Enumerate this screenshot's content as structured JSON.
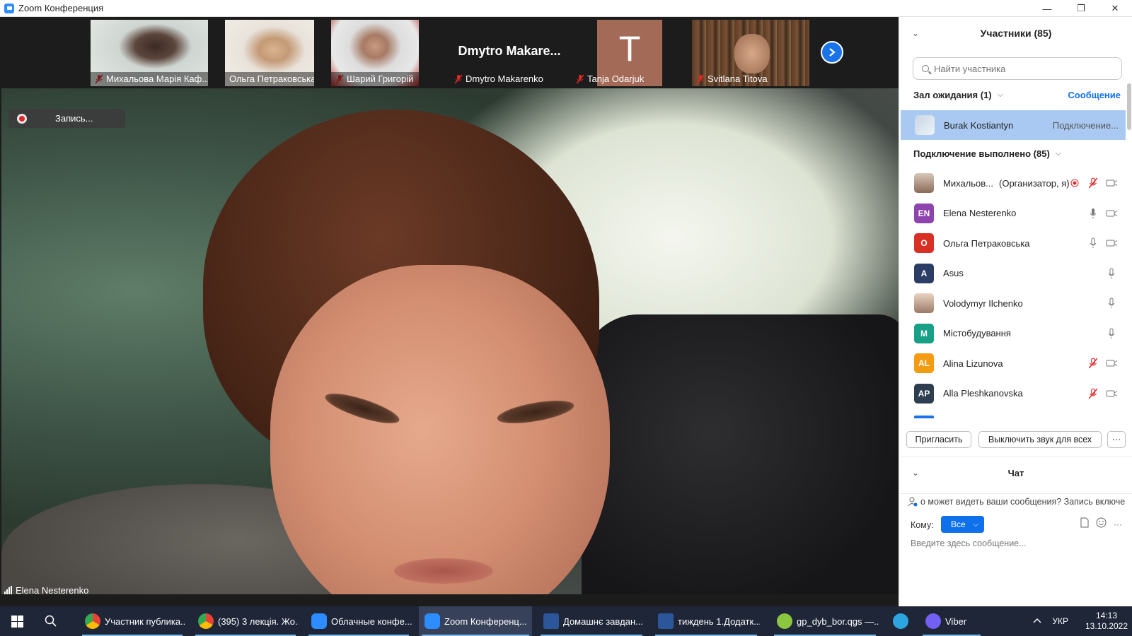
{
  "window": {
    "title": "Zoom Конференция",
    "minimize": "—",
    "maximize": "❐",
    "close": "✕"
  },
  "thumbnails": [
    {
      "name": "Михальова Марія Каф..."
    },
    {
      "name": "Ольга Петраковська"
    },
    {
      "name": "Шарий Григорій"
    },
    {
      "name": "Dmytro Makarenko",
      "display_text": "Dmytro  Makare..."
    },
    {
      "name": "Tanja Odarjuk",
      "letter": "T",
      "color": "#a36a58"
    },
    {
      "name": "Svitlana Titova"
    }
  ],
  "recording": {
    "label": "Запись..."
  },
  "active_speaker": {
    "name": "Elena Nesterenko"
  },
  "participants_panel": {
    "title": "Участники (85)",
    "search_placeholder": "Найти участника",
    "waiting_room": {
      "label": "Зал ожидания (1)",
      "message_link": "Сообщение",
      "person": {
        "name": "Burak Kostiantyn",
        "status": "Подключение..."
      }
    },
    "joined": {
      "label": "Подключение выполнено (85)"
    },
    "participants": [
      {
        "name": "Михальов...",
        "tag": "(Организатор, я)",
        "avatar_type": "photo",
        "recording": true,
        "mic": "muted",
        "video": "off"
      },
      {
        "name": "Elena Nesterenko",
        "initials": "EN",
        "color": "#8e44ad",
        "mic": "on",
        "video": "off"
      },
      {
        "name": "Ольга Петраковська",
        "initials": "О",
        "color": "#d93025",
        "mic": "on",
        "video": "off"
      },
      {
        "name": "Asus",
        "initials": "A",
        "color": "#2c3e66",
        "mic": "on",
        "video": "none"
      },
      {
        "name": "Volodymyr Ilchenko",
        "avatar_type": "photo2",
        "mic": "on",
        "video": "none"
      },
      {
        "name": "Містобудування",
        "initials": "M",
        "color": "#16a085",
        "mic": "on",
        "video": "none"
      },
      {
        "name": "Alina Lizunova",
        "initials": "AL",
        "color": "#f39c12",
        "mic": "muted",
        "video": "off"
      },
      {
        "name": "Alla Pleshkanovska",
        "initials": "AP",
        "color": "#2c3e50",
        "mic": "muted",
        "video": "off"
      }
    ],
    "invite_button": "Пригласить",
    "mute_all_button": "Выключить звук для всех",
    "more_button": "···"
  },
  "chat": {
    "title": "Чат",
    "notice": "о может видеть ваши сообщения? Запись включе",
    "to_label": "Кому:",
    "to_value": "Все",
    "input_placeholder": "Введите здесь сообщение..."
  },
  "taskbar": {
    "apps": [
      {
        "label": "Участник публика...",
        "color": "#e8453c"
      },
      {
        "label": "(395) 3 лекція. Жо...",
        "color": "#e8453c"
      },
      {
        "label": "Облачные конфе...",
        "color": "#2d8cff"
      },
      {
        "label": "Zoom Конференц...",
        "color": "#2d8cff",
        "active": true
      },
      {
        "label": "Домашнє завдан...",
        "color": "#2b579a"
      },
      {
        "label": "тиждень 1.Додатк...",
        "color": "#2b579a"
      },
      {
        "label": "gp_dyb_bor.qgs —...",
        "color": "#8cc63f"
      },
      {
        "label": "",
        "color": "#2ca5e0"
      },
      {
        "label": "Viber",
        "color": "#7360f2"
      }
    ],
    "language": "УКР",
    "time": "14:13",
    "date": "13.10.2022"
  }
}
